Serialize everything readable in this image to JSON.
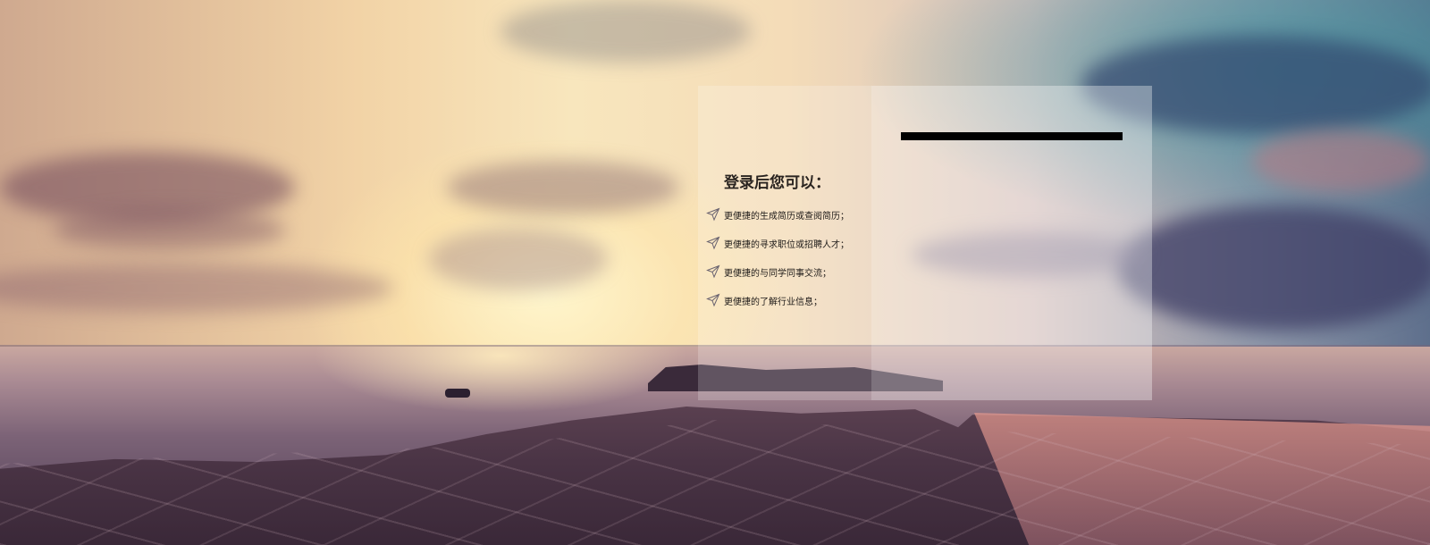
{
  "colors": {
    "panel_left_bg": "rgba(255,255,255,0.2)",
    "panel_right_bg": "rgba(255,255,255,0.34)",
    "bar": "#000000",
    "text": "#1e1a18"
  },
  "background": {
    "description_icon": "sunset-seascape-image"
  },
  "login_panel": {
    "title": "登录后您可以：",
    "benefits": [
      {
        "icon": "send-arrow-icon",
        "text": "更便捷的生成简历或查阅简历；"
      },
      {
        "icon": "send-arrow-icon",
        "text": "更便捷的寻求职位或招聘人才；"
      },
      {
        "icon": "send-arrow-icon",
        "text": "更便捷的与同学同事交流；"
      },
      {
        "icon": "send-arrow-icon",
        "text": "更便捷的了解行业信息；"
      }
    ]
  }
}
